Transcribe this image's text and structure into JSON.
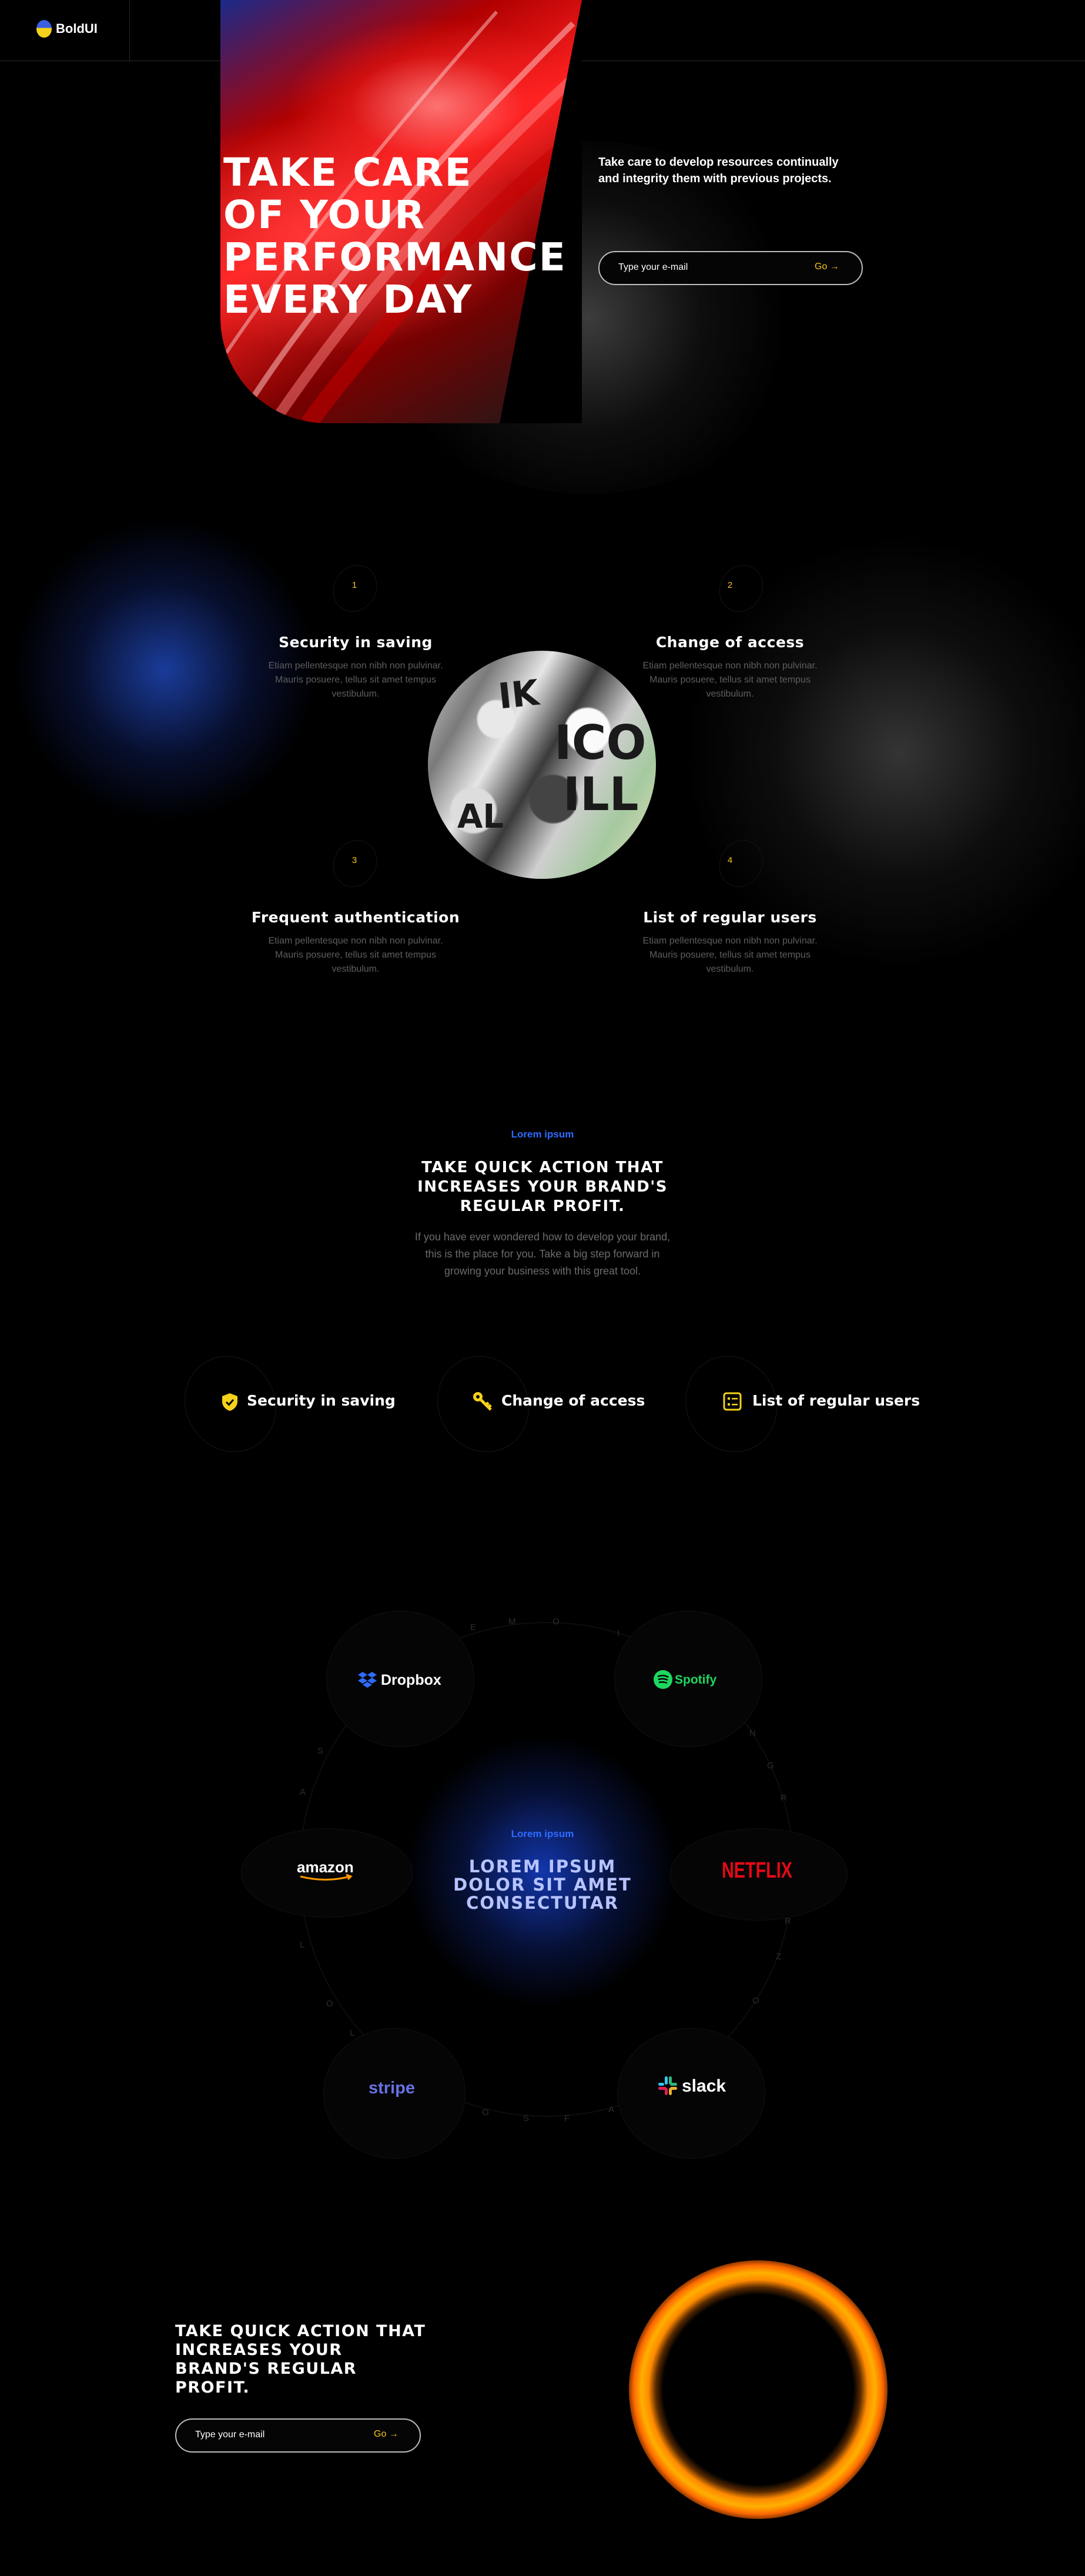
{
  "header": {
    "brand": "BoldUI"
  },
  "hero": {
    "title_lines": [
      "TAKE CARE",
      "OF YOUR",
      "PERFORMANCE",
      "EVERY DAY"
    ],
    "description": "Take care to develop resources continually and integrity them with previous projects.",
    "email_placeholder": "Type your e-mail",
    "go_label": "Go →"
  },
  "features": {
    "items": [
      {
        "number": "1",
        "title": "Security in saving",
        "desc": "Etiam pellentesque non nibh non pulvinar. Mauris posuere, tellus sit amet tempus vestibulum."
      },
      {
        "number": "2",
        "title": "Change of access",
        "desc": "Etiam pellentesque non nibh non pulvinar. Mauris posuere, tellus sit amet tempus vestibulum."
      },
      {
        "number": "3",
        "title": "Frequent authentication",
        "desc": "Etiam pellentesque non nibh non pulvinar. Mauris posuere, tellus sit amet tempus vestibulum."
      },
      {
        "number": "4",
        "title": "List of regular users",
        "desc": "Etiam pellentesque non nibh non pulvinar. Mauris posuere, tellus sit amet tempus vestibulum."
      }
    ]
  },
  "cta": {
    "eyebrow": "Lorem ipsum",
    "title": "TAKE QUICK ACTION THAT INCREASES YOUR BRAND'S REGULAR PROFIT.",
    "description": "If you have ever wondered how to develop your brand, this is the place for you. Take a big step forward in growing your business with this great tool.",
    "pills": [
      {
        "label": "Security in saving",
        "icon": "shield-check-icon"
      },
      {
        "label": "Change of access",
        "icon": "key-icon"
      },
      {
        "label": "List of regular users",
        "icon": "list-icon"
      }
    ]
  },
  "partners": {
    "eyebrow": "Lorem ipsum",
    "title": "LOREM IPSUM DOLOR SIT AMET CONSECTUTAR",
    "logos": [
      "Dropbox",
      "Spotify",
      "amazon",
      "NETFLIX",
      "stripe",
      "slack"
    ]
  },
  "bottom": {
    "title": "TAKE QUICK ACTION THAT INCREASES YOUR BRAND'S REGULAR PROFIT.",
    "email_placeholder": "Type your e-mail",
    "go_label": "Go →"
  }
}
